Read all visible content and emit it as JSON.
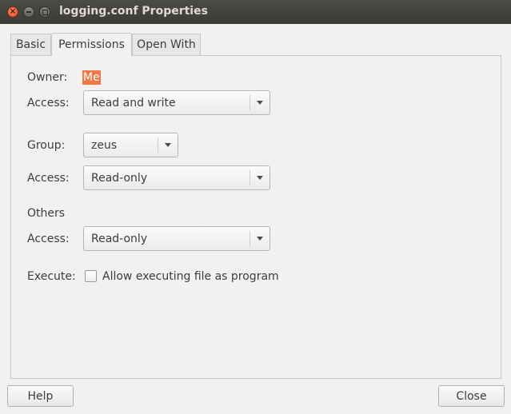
{
  "window": {
    "title": "logging.conf Properties"
  },
  "tabs": [
    {
      "label": "Basic"
    },
    {
      "label": "Permissions"
    },
    {
      "label": "Open With"
    }
  ],
  "permissions": {
    "owner_label": "Owner:",
    "owner_value": "Me",
    "owner_access_label": "Access:",
    "owner_access_value": "Read and write",
    "group_label": "Group:",
    "group_value": "zeus",
    "group_access_label": "Access:",
    "group_access_value": "Read-only",
    "others_heading": "Others",
    "others_access_label": "Access:",
    "others_access_value": "Read-only",
    "execute_label": "Execute:",
    "execute_checkbox_label": "Allow executing file as program",
    "execute_checked": false
  },
  "buttons": {
    "help": "Help",
    "close": "Close"
  },
  "colors": {
    "titlebar": "#3c3b37",
    "selection": "#f07746",
    "close_button": "#e0491f"
  }
}
